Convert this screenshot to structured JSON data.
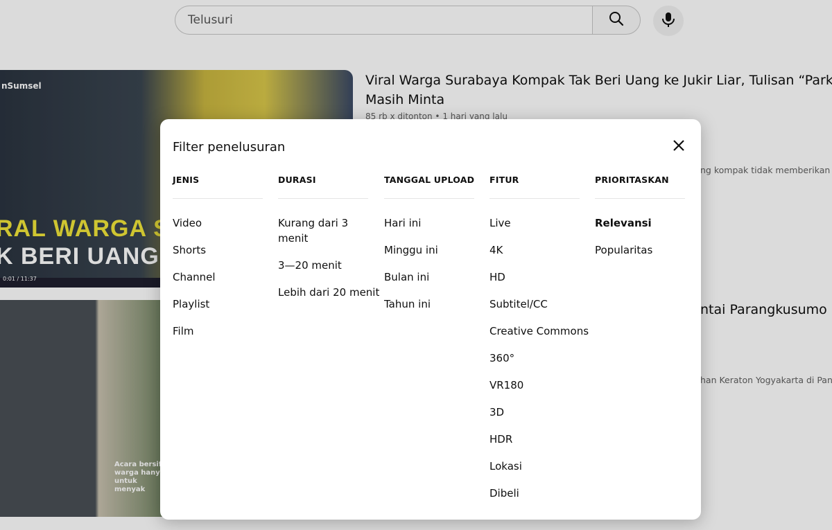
{
  "search": {
    "placeholder": "Telusuri"
  },
  "results": [
    {
      "title_line1": "Viral Warga Surabaya Kompak Tak Beri Uang ke Jukir Liar, Tulisan “Parkir Gr",
      "title_line2": "Masih Minta",
      "meta": "85 rb x ditonton • 1 hari yang lalu",
      "description": "ng kompak tidak memberikan u",
      "thumb_caption_1": "RAL WARGA SURA",
      "thumb_caption_2": "K BERI UANG KE J",
      "thumb_logo": "nSumsel",
      "thumb_timestamp": "0:01 / 11:37"
    },
    {
      "title_line1": "ntai Parangkusumo",
      "description": "han Keraton Yogyakarta di Panta",
      "thumb_caption": "Acara bersifat warga hanya untuk menyak"
    }
  ],
  "dialog": {
    "title": "Filter penelusuran",
    "columns": [
      {
        "header": "JENIS",
        "options": [
          "Video",
          "Shorts",
          "Channel",
          "Playlist",
          "Film"
        ]
      },
      {
        "header": "DURASI",
        "options": [
          "Kurang dari 3 menit",
          "3—20 menit",
          "Lebih dari 20 menit"
        ]
      },
      {
        "header": "TANGGAL UPLOAD",
        "options": [
          "Hari ini",
          "Minggu ini",
          "Bulan ini",
          "Tahun ini"
        ]
      },
      {
        "header": "FITUR",
        "options": [
          "Live",
          "4K",
          "HD",
          "Subtitel/CC",
          "Creative Commons",
          "360°",
          "VR180",
          "3D",
          "HDR",
          "Lokasi",
          "Dibeli"
        ]
      },
      {
        "header": "PRIORITASKAN",
        "options": [
          "Relevansi",
          "Popularitas"
        ],
        "selected": "Relevansi"
      }
    ]
  },
  "icons": {
    "search": "search-icon",
    "mic": "mic-icon",
    "close": "close-icon"
  }
}
